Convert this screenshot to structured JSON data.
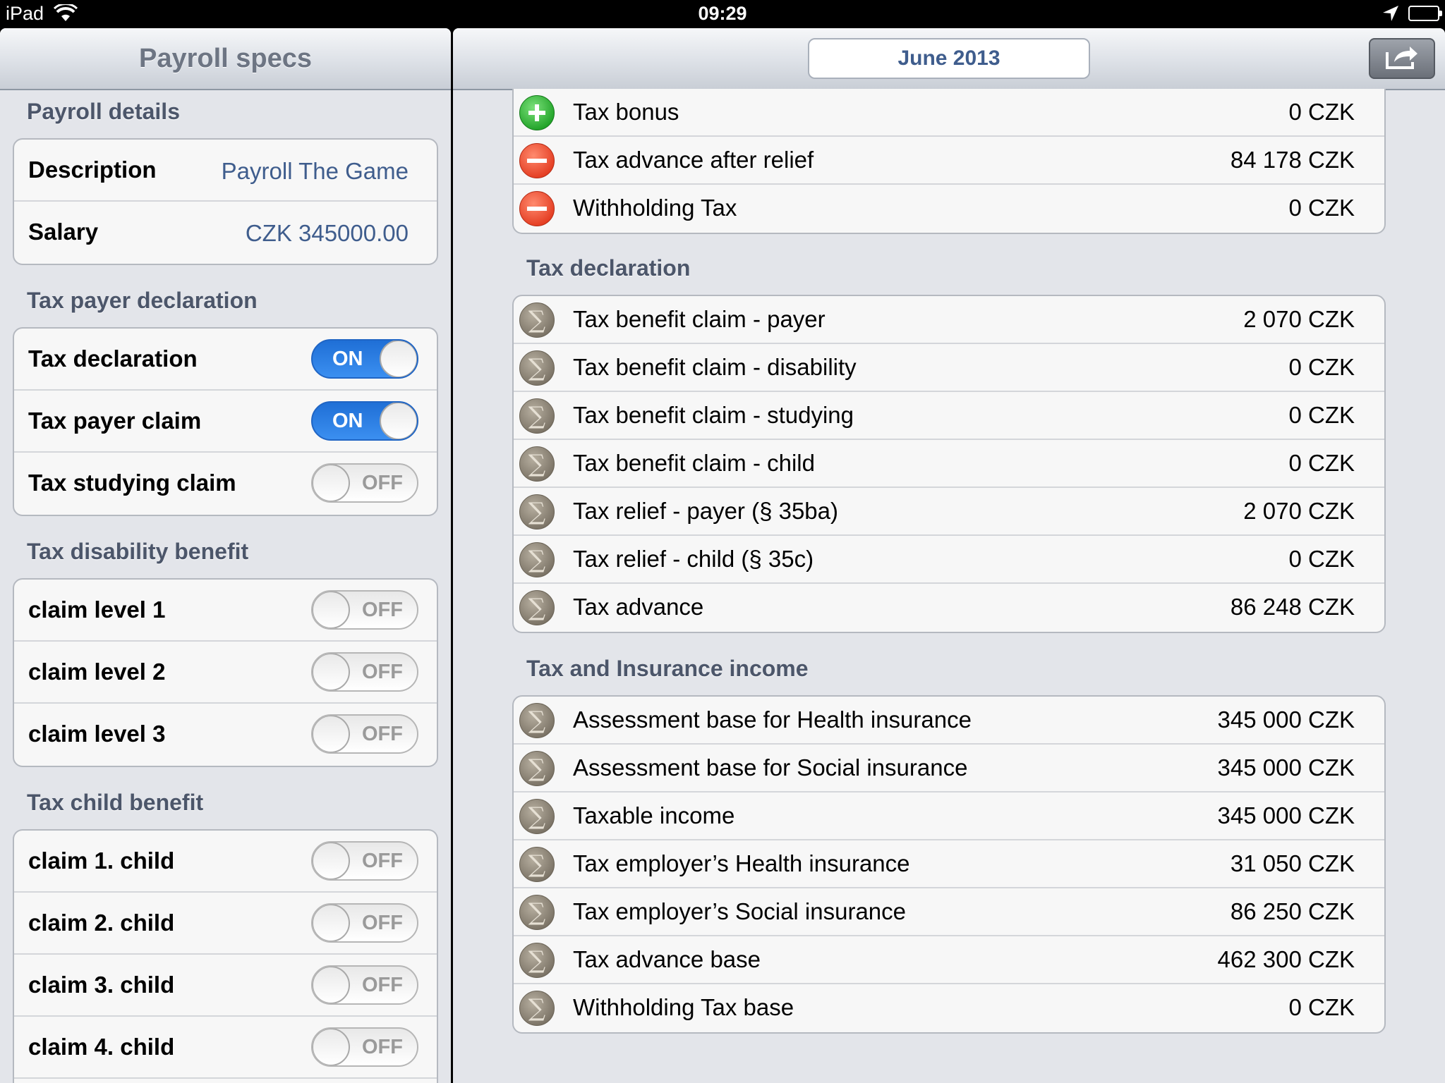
{
  "status_bar": {
    "carrier": "iPad",
    "time": "09:29"
  },
  "master": {
    "title": "Payroll specs",
    "sections": {
      "payroll_details": {
        "header": "Payroll details",
        "description_label": "Description",
        "description_value": "Payroll The Game",
        "salary_label": "Salary",
        "salary_value": "CZK 345000.00"
      },
      "tax_payer": {
        "header": "Tax payer declaration",
        "items": [
          {
            "label": "Tax declaration",
            "state": "ON"
          },
          {
            "label": "Tax payer claim",
            "state": "ON"
          },
          {
            "label": "Tax studying claim",
            "state": "OFF"
          }
        ]
      },
      "disability": {
        "header": "Tax disability benefit",
        "items": [
          {
            "label": "claim level 1",
            "state": "OFF"
          },
          {
            "label": "claim level 2",
            "state": "OFF"
          },
          {
            "label": "claim level 3",
            "state": "OFF"
          }
        ]
      },
      "child": {
        "header": "Tax child benefit",
        "items": [
          {
            "label": "claim 1. child",
            "state": "OFF"
          },
          {
            "label": "claim 2. child",
            "state": "OFF"
          },
          {
            "label": "claim 3. child",
            "state": "OFF"
          },
          {
            "label": "claim 4. child",
            "state": "OFF"
          }
        ]
      }
    }
  },
  "detail": {
    "month": "June 2013",
    "top_group": [
      {
        "icon": "plus-icon",
        "label": "Tax bonus",
        "amount": "0 CZK"
      },
      {
        "icon": "minus-icon",
        "label": "Tax advance after relief",
        "amount": "84 178 CZK"
      },
      {
        "icon": "minus-icon",
        "label": "Withholding Tax",
        "amount": "0 CZK"
      }
    ],
    "tax_declaration": {
      "header": "Tax declaration",
      "rows": [
        {
          "icon": "sum-icon",
          "label": "Tax benefit claim - payer",
          "amount": "2 070 CZK"
        },
        {
          "icon": "sum-icon",
          "label": "Tax benefit claim - disability",
          "amount": "0 CZK"
        },
        {
          "icon": "sum-icon",
          "label": "Tax benefit claim - studying",
          "amount": "0 CZK"
        },
        {
          "icon": "sum-icon",
          "label": "Tax benefit claim - child",
          "amount": "0 CZK"
        },
        {
          "icon": "sum-icon",
          "label": "Tax relief - payer (§ 35ba)",
          "amount": "2 070 CZK"
        },
        {
          "icon": "sum-icon",
          "label": "Tax relief - child (§ 35c)",
          "amount": "0 CZK"
        },
        {
          "icon": "sum-icon",
          "label": "Tax advance",
          "amount": "86 248 CZK"
        }
      ]
    },
    "tax_insurance": {
      "header": "Tax and Insurance income",
      "rows": [
        {
          "icon": "sum-icon",
          "label": "Assessment base for Health insurance",
          "amount": "345 000 CZK"
        },
        {
          "icon": "sum-icon",
          "label": "Assessment base for Social insurance",
          "amount": "345 000 CZK"
        },
        {
          "icon": "sum-icon",
          "label": "Taxable income",
          "amount": "345 000 CZK"
        },
        {
          "icon": "sum-icon",
          "label": "Tax employer’s Health insurance",
          "amount": "31 050 CZK"
        },
        {
          "icon": "sum-icon",
          "label": "Tax employer’s Social insurance",
          "amount": "86 250 CZK"
        },
        {
          "icon": "sum-icon",
          "label": "Tax advance base",
          "amount": "462 300 CZK"
        },
        {
          "icon": "sum-icon",
          "label": "Withholding Tax base",
          "amount": "0 CZK"
        }
      ]
    },
    "sum_symbol": "∑"
  }
}
